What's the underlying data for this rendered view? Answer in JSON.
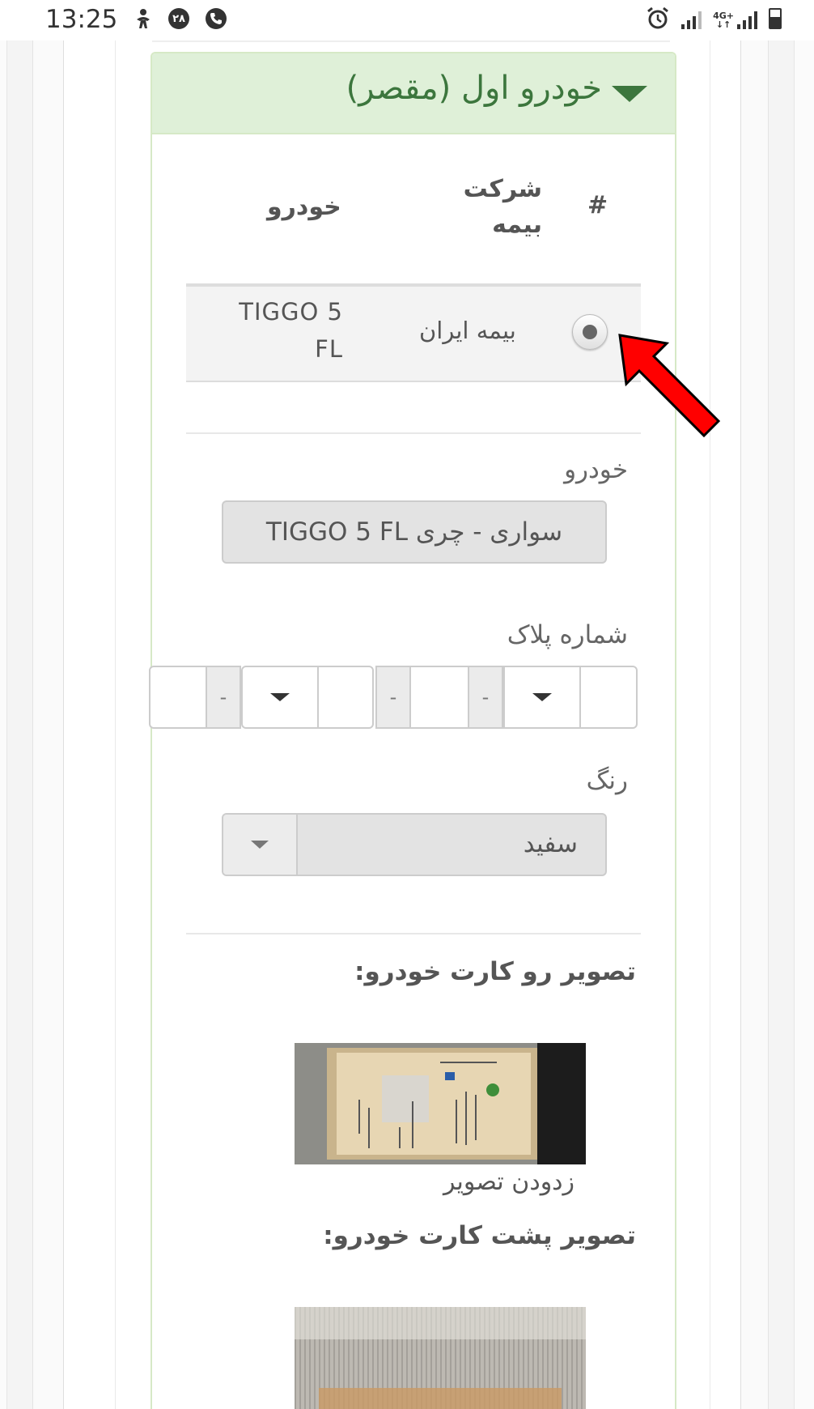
{
  "status_bar": {
    "time": "13:25",
    "icons": [
      "accessibility-icon",
      "notification-badge-icon",
      "phone-icon",
      "alarm-icon",
      "signal-icon",
      "signal-4g-icon",
      "battery-icon"
    ],
    "badge": "۲۸",
    "network": "4G+"
  },
  "panel": {
    "title": "خودرو اول (مقصر)",
    "accent_color": "#3c763d",
    "header_bg": "#dff0d8"
  },
  "table": {
    "headers": {
      "index": "#",
      "insurer_line1": "شرکت",
      "insurer_line2": "بیمه",
      "vehicle": "خودرو"
    },
    "rows": [
      {
        "selected": true,
        "insurer": "بیمه ایران",
        "vehicle_line1": "TIGGO 5",
        "vehicle_line2": "FL"
      }
    ]
  },
  "form": {
    "vehicle_label": "خودرو",
    "vehicle_value": "سواری - چری TIGGO 5 FL",
    "plate_label": "شماره پلاک",
    "plate_separator": "-",
    "color_label": "رنگ",
    "color_value": "سفید"
  },
  "documents": {
    "front_label": "تصویر رو کارت خودرو:",
    "remove_label": "زدودن تصویر",
    "back_label": "تصویر پشت کارت خودرو:"
  },
  "annotation": {
    "arrow_color": "#ff0000"
  }
}
